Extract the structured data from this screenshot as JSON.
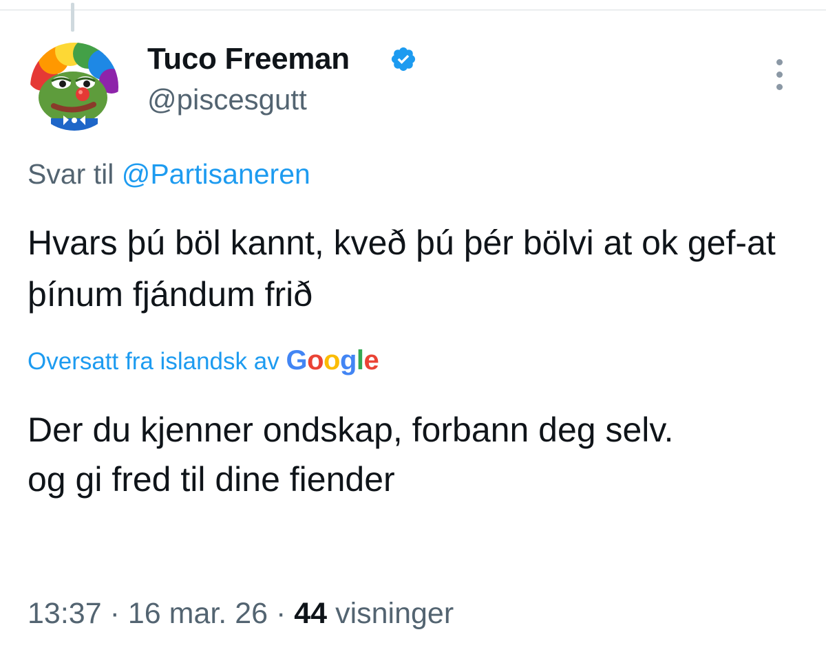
{
  "tweet": {
    "author": {
      "display_name": "Tuco Freeman",
      "handle": "@piscesgutt",
      "verified": true,
      "avatar_icon": "clown-frog-avatar"
    },
    "reply_prefix": "Svar til",
    "reply_to": "@Partisaneren",
    "text": "Hvars þú böl kannt, kveð þú þér bölvi at ok gef-at þínum fjándum frið",
    "translation_label": "Oversatt fra islandsk av",
    "translation_provider": "Google",
    "translated_text": "Der du kjenner ondskap, forbann deg selv.\nog gi fred til dine fiender",
    "time": "13:37",
    "date": "16 mar. 26",
    "separator": "·",
    "views": "44",
    "views_label": "visninger"
  },
  "colors": {
    "accent": "#1d9bf0",
    "secondary_text": "#536471",
    "primary_text": "#0f1419",
    "google_blue": "#4285f4",
    "google_red": "#ea4335",
    "google_yellow": "#fbbc05",
    "google_green": "#34a853"
  }
}
